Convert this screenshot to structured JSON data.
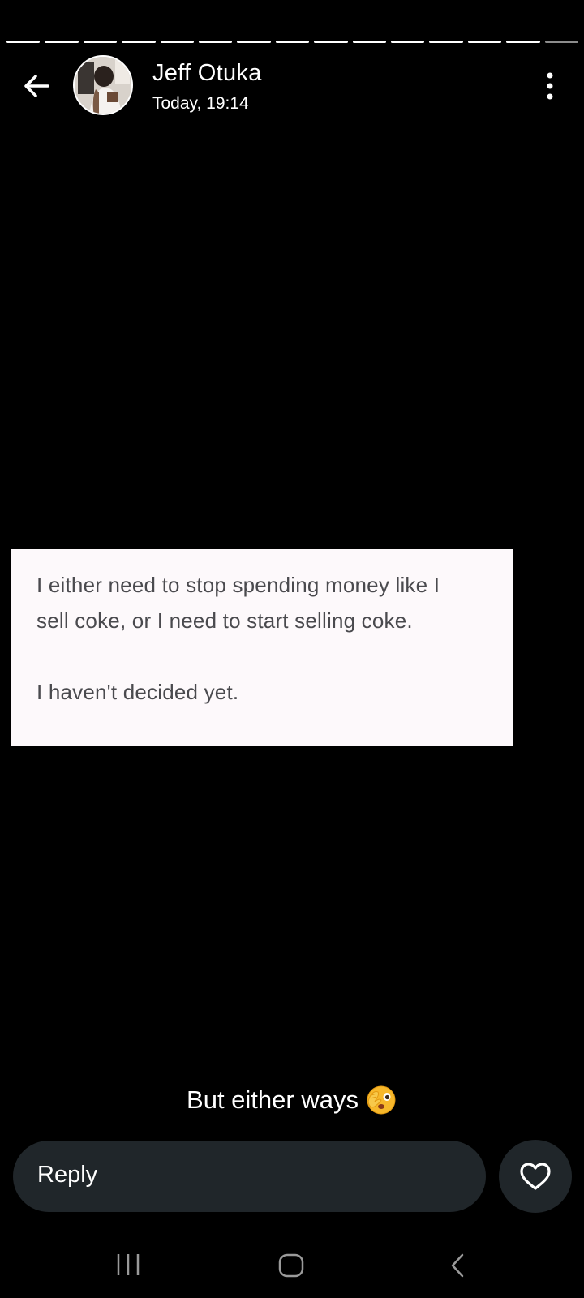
{
  "story": {
    "segment_count": 15,
    "current_segment": 15
  },
  "header": {
    "name": "Jeff Otuka",
    "time": "Today, 19:14",
    "icons": {
      "back": "arrow-left-icon",
      "more": "more-vertical-icon"
    }
  },
  "story_card": {
    "line1": "I either need to stop spending money like I",
    "line2": "sell coke, or I need to start selling coke.",
    "line3": "I haven't decided yet."
  },
  "caption": {
    "text": "But either ways",
    "emoji": "face-with-peeking-eye-emoji"
  },
  "reply": {
    "placeholder": "Reply",
    "like_icon": "heart-icon"
  },
  "navbar": {
    "icons": [
      "recent-apps-icon",
      "home-icon",
      "back-icon"
    ]
  },
  "colors": {
    "background": "#000000",
    "bar": "#20262a",
    "card": "#fdf9fb",
    "card_text": "#4a4a4e"
  }
}
